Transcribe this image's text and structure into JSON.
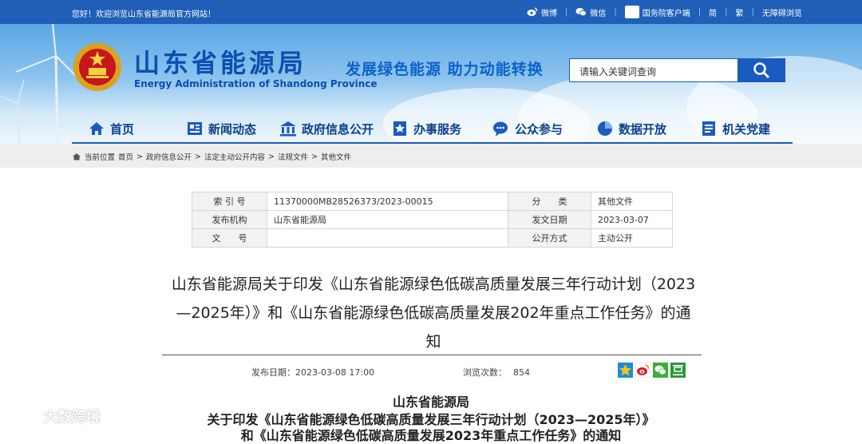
{
  "topbar": {
    "welcome": "您好！欢迎浏览山东省能源局官方网站！",
    "weibo": "微博",
    "wechat": "微信",
    "gwy": "国务院客户端",
    "simplified": "简",
    "traditional": "繁",
    "accessible": "无障碍浏览"
  },
  "header": {
    "org_name": "山东省能源局",
    "org_en": "Energy Administration of Shandong Province",
    "slogan": "发展绿色能源 助力动能转换",
    "search_placeholder": "请输入关键词查询"
  },
  "nav": {
    "items": [
      {
        "label": "首页",
        "icon": "home-icon"
      },
      {
        "label": "新闻动态",
        "icon": "news-icon"
      },
      {
        "label": "政府信息公开",
        "icon": "government-icon"
      },
      {
        "label": "办事服务",
        "icon": "service-icon"
      },
      {
        "label": "公众参与",
        "icon": "chat-icon"
      },
      {
        "label": "数据开放",
        "icon": "pie-chart-icon"
      },
      {
        "label": "机关党建",
        "icon": "party-icon"
      }
    ]
  },
  "breadcrumb": {
    "current": "当前位置",
    "items": [
      "首页",
      "政府信息公开",
      "法定主动公开内容",
      "法规文件",
      "其他文件"
    ]
  },
  "info": {
    "index_label": "索 引 号",
    "index_value": "11370000MB28526373/2023-00015",
    "category_label": "分　　类",
    "category_value": "其他文件",
    "publisher_label": "发布机构",
    "publisher_value": "山东省能源局",
    "date_label": "发文日期",
    "date_value": "2023-03-07",
    "docno_label": "文　　号",
    "docno_value": "",
    "open_label": "公开方式",
    "open_value": "主动公开"
  },
  "article": {
    "title_line1": "山东省能源局关于印发《山东省能源绿色低碳高质量发展三年行动计划（2023",
    "title_line2": "—2025年）》和《山东省能源绿色低碳高质量发展202年重点工作任务》的通",
    "title_line3": "知",
    "publish_label": "发布日期：",
    "publish_value": "2023-03-08 17:00",
    "views_label": "浏览次数：",
    "views_value": "854",
    "body_org": "山东省能源局",
    "body_line1": "关于印发《山东省能源绿色低碳高质量发展三年行动计划（2023—2025年）》",
    "body_line2": "和《山东省能源绿色低碳高质量发展2023年重点工作任务》的通知"
  },
  "watermark": "大数跨境",
  "colors": {
    "topbar": "#1f5fb8",
    "brand_blue": "#0b4fb0",
    "nav_text": "#0b3f8f",
    "search_button": "#1a5bbf"
  }
}
